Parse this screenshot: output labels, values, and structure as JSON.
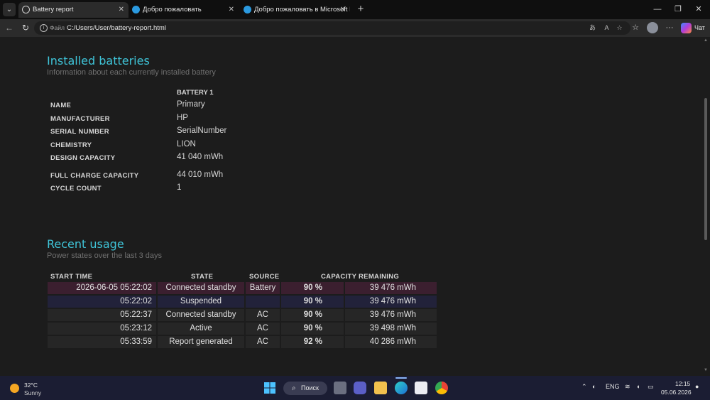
{
  "browser": {
    "tabs": [
      {
        "title": "Battery report",
        "active": true
      },
      {
        "title": "Добро пожаловать",
        "active": false
      },
      {
        "title": "Добро пожаловать в Microsoft E",
        "active": false
      }
    ],
    "address": {
      "file_label": "Файл",
      "url": "C:/Users/User/battery-report.html"
    },
    "copilot_label": "Чат"
  },
  "installed": {
    "title": "Installed batteries",
    "subtitle": "Information about each currently installed battery",
    "battery_header": "BATTERY 1",
    "rows": [
      {
        "label": "NAME",
        "value": "Primary"
      },
      {
        "label": "MANUFACTURER",
        "value": "HP"
      },
      {
        "label": "SERIAL NUMBER",
        "value": "SerialNumber"
      },
      {
        "label": "CHEMISTRY",
        "value": "LION"
      },
      {
        "label": "DESIGN CAPACITY",
        "value": "41 040 mWh"
      },
      {
        "label": "FULL CHARGE CAPACITY",
        "value": "44 010 mWh"
      },
      {
        "label": "CYCLE COUNT",
        "value": "1"
      }
    ]
  },
  "recent": {
    "title": "Recent usage",
    "subtitle": "Power states over the last 3 days",
    "headers": {
      "start_time": "START TIME",
      "state": "STATE",
      "source": "SOURCE",
      "capacity": "CAPACITY REMAINING"
    },
    "rows": [
      {
        "time": "2026-06-05  05:22:02",
        "state": "Connected standby",
        "source": "Battery",
        "pct": "90 %",
        "mwh": "39 476 mWh",
        "bg": "#3b1f2f"
      },
      {
        "time": "05:22:02",
        "state": "Suspended",
        "source": "",
        "pct": "90 %",
        "mwh": "39 476 mWh",
        "bg": "#22223a"
      },
      {
        "time": "05:22:37",
        "state": "Connected standby",
        "source": "AC",
        "pct": "90 %",
        "mwh": "39 476 mWh",
        "bg": "#262626"
      },
      {
        "time": "05:23:12",
        "state": "Active",
        "source": "AC",
        "pct": "90 %",
        "mwh": "39 498 mWh",
        "bg": "#262626"
      },
      {
        "time": "05:33:59",
        "state": "Report generated",
        "source": "AC",
        "pct": "92 %",
        "mwh": "40 286 mWh",
        "bg": "#262626"
      }
    ]
  },
  "taskbar": {
    "weather_temp": "32°C",
    "weather_cond": "Sunny",
    "search_label": "Поиск",
    "lang": "ENG",
    "time": "12:15",
    "date": "05.06.2026"
  },
  "colors": {
    "accent": "#3fc4d8",
    "row_battery": "#3b1f2f",
    "row_suspended": "#22223a",
    "row_ac": "#262626"
  }
}
